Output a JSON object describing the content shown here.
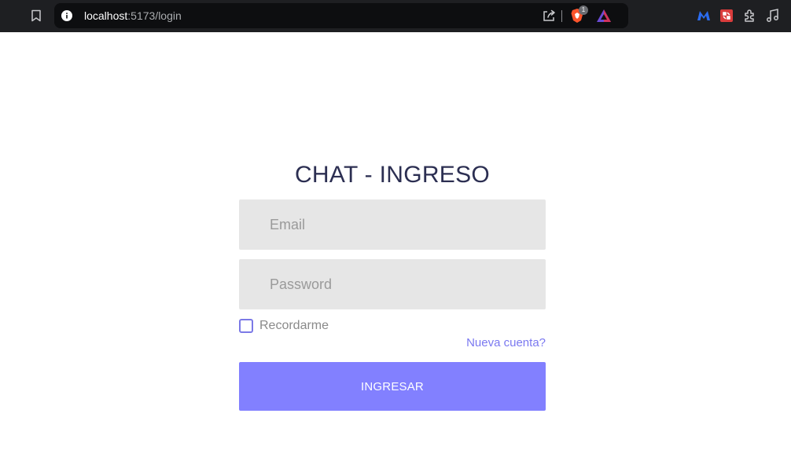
{
  "browser": {
    "url_host": "localhost",
    "url_rest": ":5173/login",
    "brave_badge_count": "1",
    "icons": [
      "bookmark-icon",
      "site-info-icon",
      "share-icon",
      "brave-shields-icon",
      "brave-rewards-icon",
      "malwarebytes-icon",
      "extension-red-icon",
      "extensions-puzzle-icon",
      "media-controls-icon"
    ]
  },
  "login": {
    "title": "CHAT - INGRESO",
    "email_placeholder": "Email",
    "password_placeholder": "Password",
    "remember_label": "Recordarme",
    "new_account_label": "Nueva cuenta?",
    "submit_label": "INGRESAR"
  },
  "colors": {
    "accent": "#8280ff",
    "title": "#2c2f52",
    "field_bg": "#e6e6e6",
    "link": "#7a78f0"
  }
}
